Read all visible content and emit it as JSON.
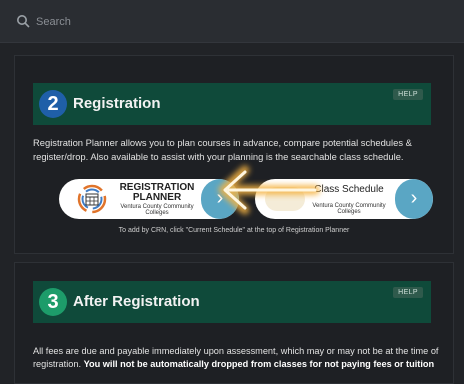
{
  "search": {
    "placeholder": "Search"
  },
  "sections": [
    {
      "number": "2",
      "title": "Registration",
      "help_label": "HELP",
      "description": "Registration Planner allows you to plan courses in advance, compare potential schedules & register/drop. Also available to assist with your planning is the searchable class schedule.",
      "planner_banner": {
        "title": "REGISTRATION PLANNER",
        "subtitle": "Ventura County Community Colleges"
      },
      "schedule_banner": {
        "title": "Class Schedule",
        "subtitle": "Ventura County Community Colleges"
      },
      "caption": "To add by CRN, click \"Current Schedule\" at the top of Registration Planner"
    },
    {
      "number": "3",
      "title": "After Registration",
      "help_label": "HELP",
      "body_start": "All fees are due and payable immediately upon assessment, which may or may not be at the time of registration. ",
      "body_bold": "You will not be automatically dropped from classes for not paying fees or tuition"
    }
  ],
  "colors": {
    "background": "#212327",
    "header_green": "#0f4a3a",
    "step2_circle": "#1f5fa8",
    "step3_circle": "#1d9c6a",
    "banner_arrow": "#5aa6c4",
    "highlight_arrow": "#f5b342"
  },
  "icons": {
    "search": "search-icon",
    "planner_logo": "calendar-grid-icon",
    "arrow": "chevron-right-icon",
    "highlight": "highlight-arrow-icon"
  }
}
